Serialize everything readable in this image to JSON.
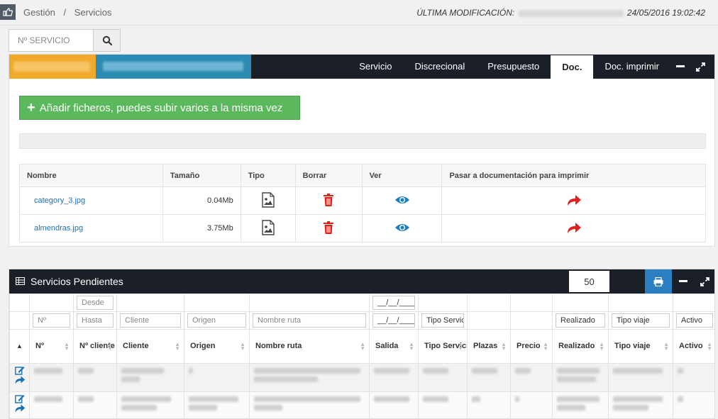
{
  "breadcrumb": {
    "root": "Gestión",
    "sep": "/",
    "current": "Servicios"
  },
  "last_modified": {
    "label": "ÚLTIMA MODIFICACIÓN:",
    "datetime": "24/05/2016 19:02:42"
  },
  "search": {
    "placeholder": "Nº SERVICIO"
  },
  "service_panel": {
    "tabs": [
      "Servicio",
      "Discrecional",
      "Presupuesto",
      "Doc.",
      "Doc. imprimir"
    ],
    "active_tab": "Doc.",
    "add_button": "Añadir ficheros, puedes subir varios a la misma vez",
    "file_columns": [
      "Nombre",
      "Tamaño",
      "Tipo",
      "Borrar",
      "Ver",
      "Pasar a documentación para imprimir"
    ],
    "files": [
      {
        "name": "category_3.jpg",
        "size": "0.04Mb"
      },
      {
        "name": "almendras.jpg",
        "size": "3.75Mb"
      }
    ]
  },
  "pending_panel": {
    "title": "Servicios Pendientes",
    "page_size": "50",
    "filters": {
      "desde": "Desde",
      "hasta": "Hasta",
      "num": "Nº",
      "cliente": "Cliente",
      "origen": "Origen",
      "nombre_ruta": "Nombre ruta",
      "fecha1": "__/__/____",
      "fecha2": "__/__/____",
      "tipo_servicio": "Tipo Servici",
      "realizado": "Realizado",
      "tipo_viaje": "Tipo viaje",
      "activo": "Activo"
    },
    "columns": [
      "Nº",
      "Nº cliente",
      "Cliente",
      "Origen",
      "Nombre ruta",
      "Salida",
      "Tipo Servicio",
      "Plazas",
      "Precio",
      "Realizado",
      "Tipo viaje",
      "Activo"
    ]
  },
  "colors": {
    "dark_header": "#1b1f28",
    "accent_blue": "#2b7fc0",
    "success_green": "#5cb85c",
    "danger_red": "#e0201b",
    "orange": "#f0a92b",
    "teal": "#2b8bb2"
  }
}
